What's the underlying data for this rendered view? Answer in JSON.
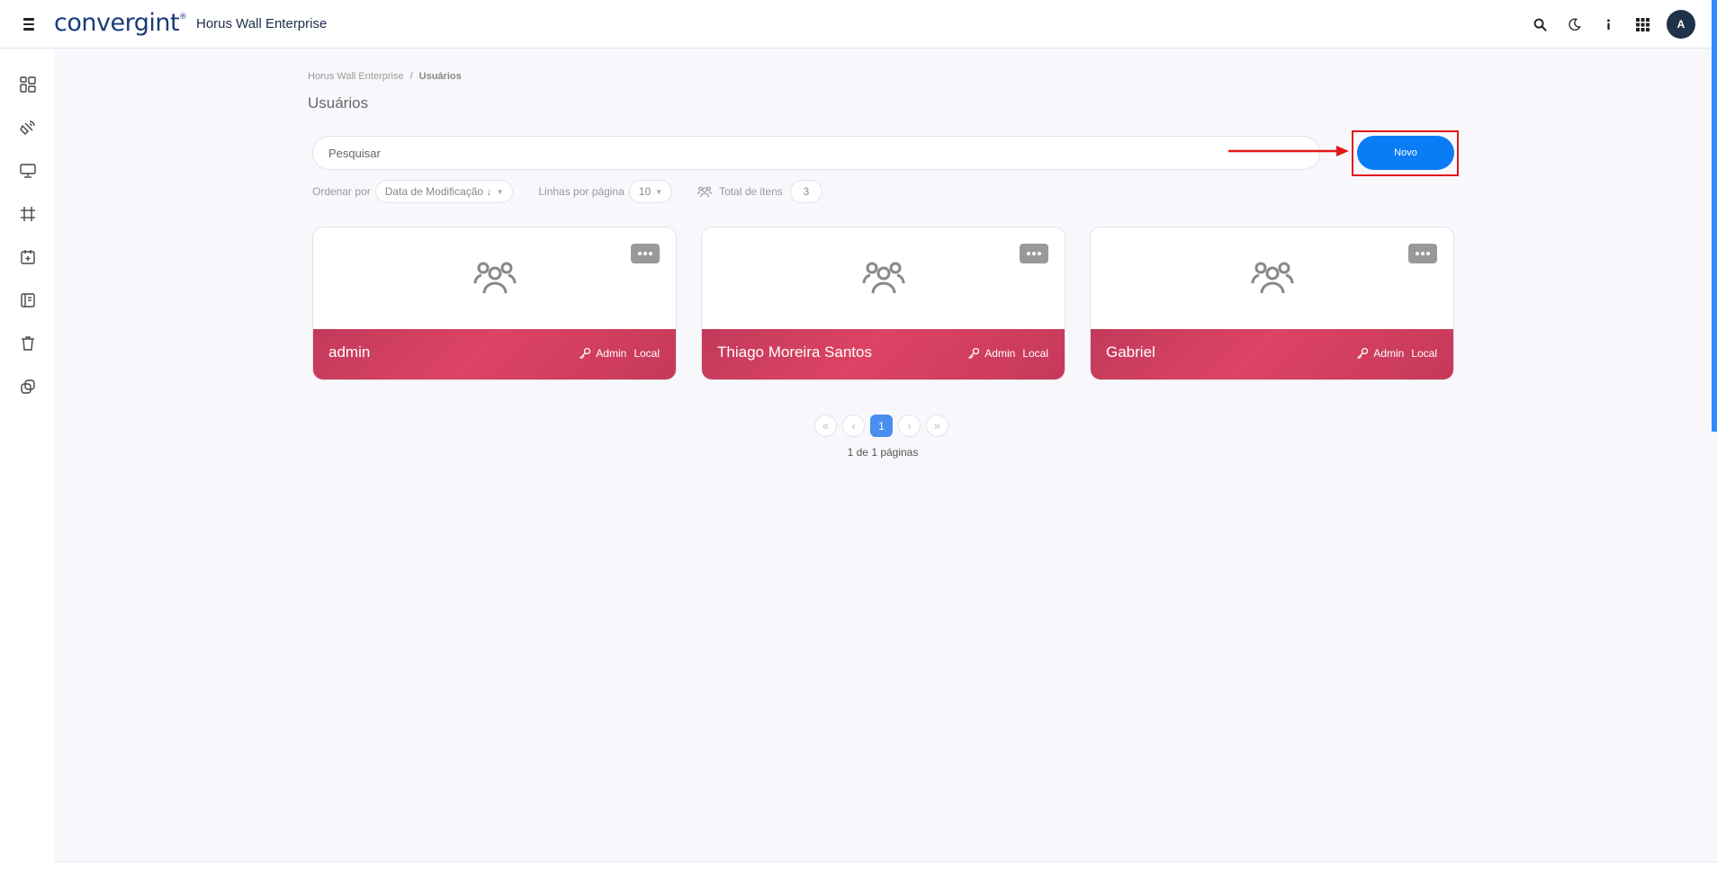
{
  "header": {
    "logo_text": "convergint",
    "logo_tm": "®",
    "app_title": "Horus Wall Enterprise",
    "avatar_initial": "A"
  },
  "breadcrumb": {
    "root": "Horus Wall Enterprise",
    "separator": "/",
    "current": "Usuários"
  },
  "page": {
    "title": "Usuários"
  },
  "search": {
    "placeholder": "Pesquisar"
  },
  "toolbar": {
    "new_label": "Novo"
  },
  "controls": {
    "sort_label": "Ordenar por",
    "sort_value": "Data de Modificação ↓",
    "rows_label": "Linhas por página",
    "rows_value": "10",
    "total_label": "Total de itens",
    "total_value": "3"
  },
  "users": [
    {
      "name": "admin",
      "role": "Admin",
      "source": "Local"
    },
    {
      "name": "Thiago Moreira Santos",
      "role": "Admin",
      "source": "Local"
    },
    {
      "name": "Gabriel",
      "role": "Admin",
      "source": "Local"
    }
  ],
  "pagination": {
    "first": "«",
    "prev": "‹",
    "current": "1",
    "next": "›",
    "last": "»",
    "info": "1 de 1 páginas"
  },
  "colors": {
    "accent": "#0a7cf6",
    "card_footer": "#d4405f",
    "highlight": "#e21818"
  }
}
